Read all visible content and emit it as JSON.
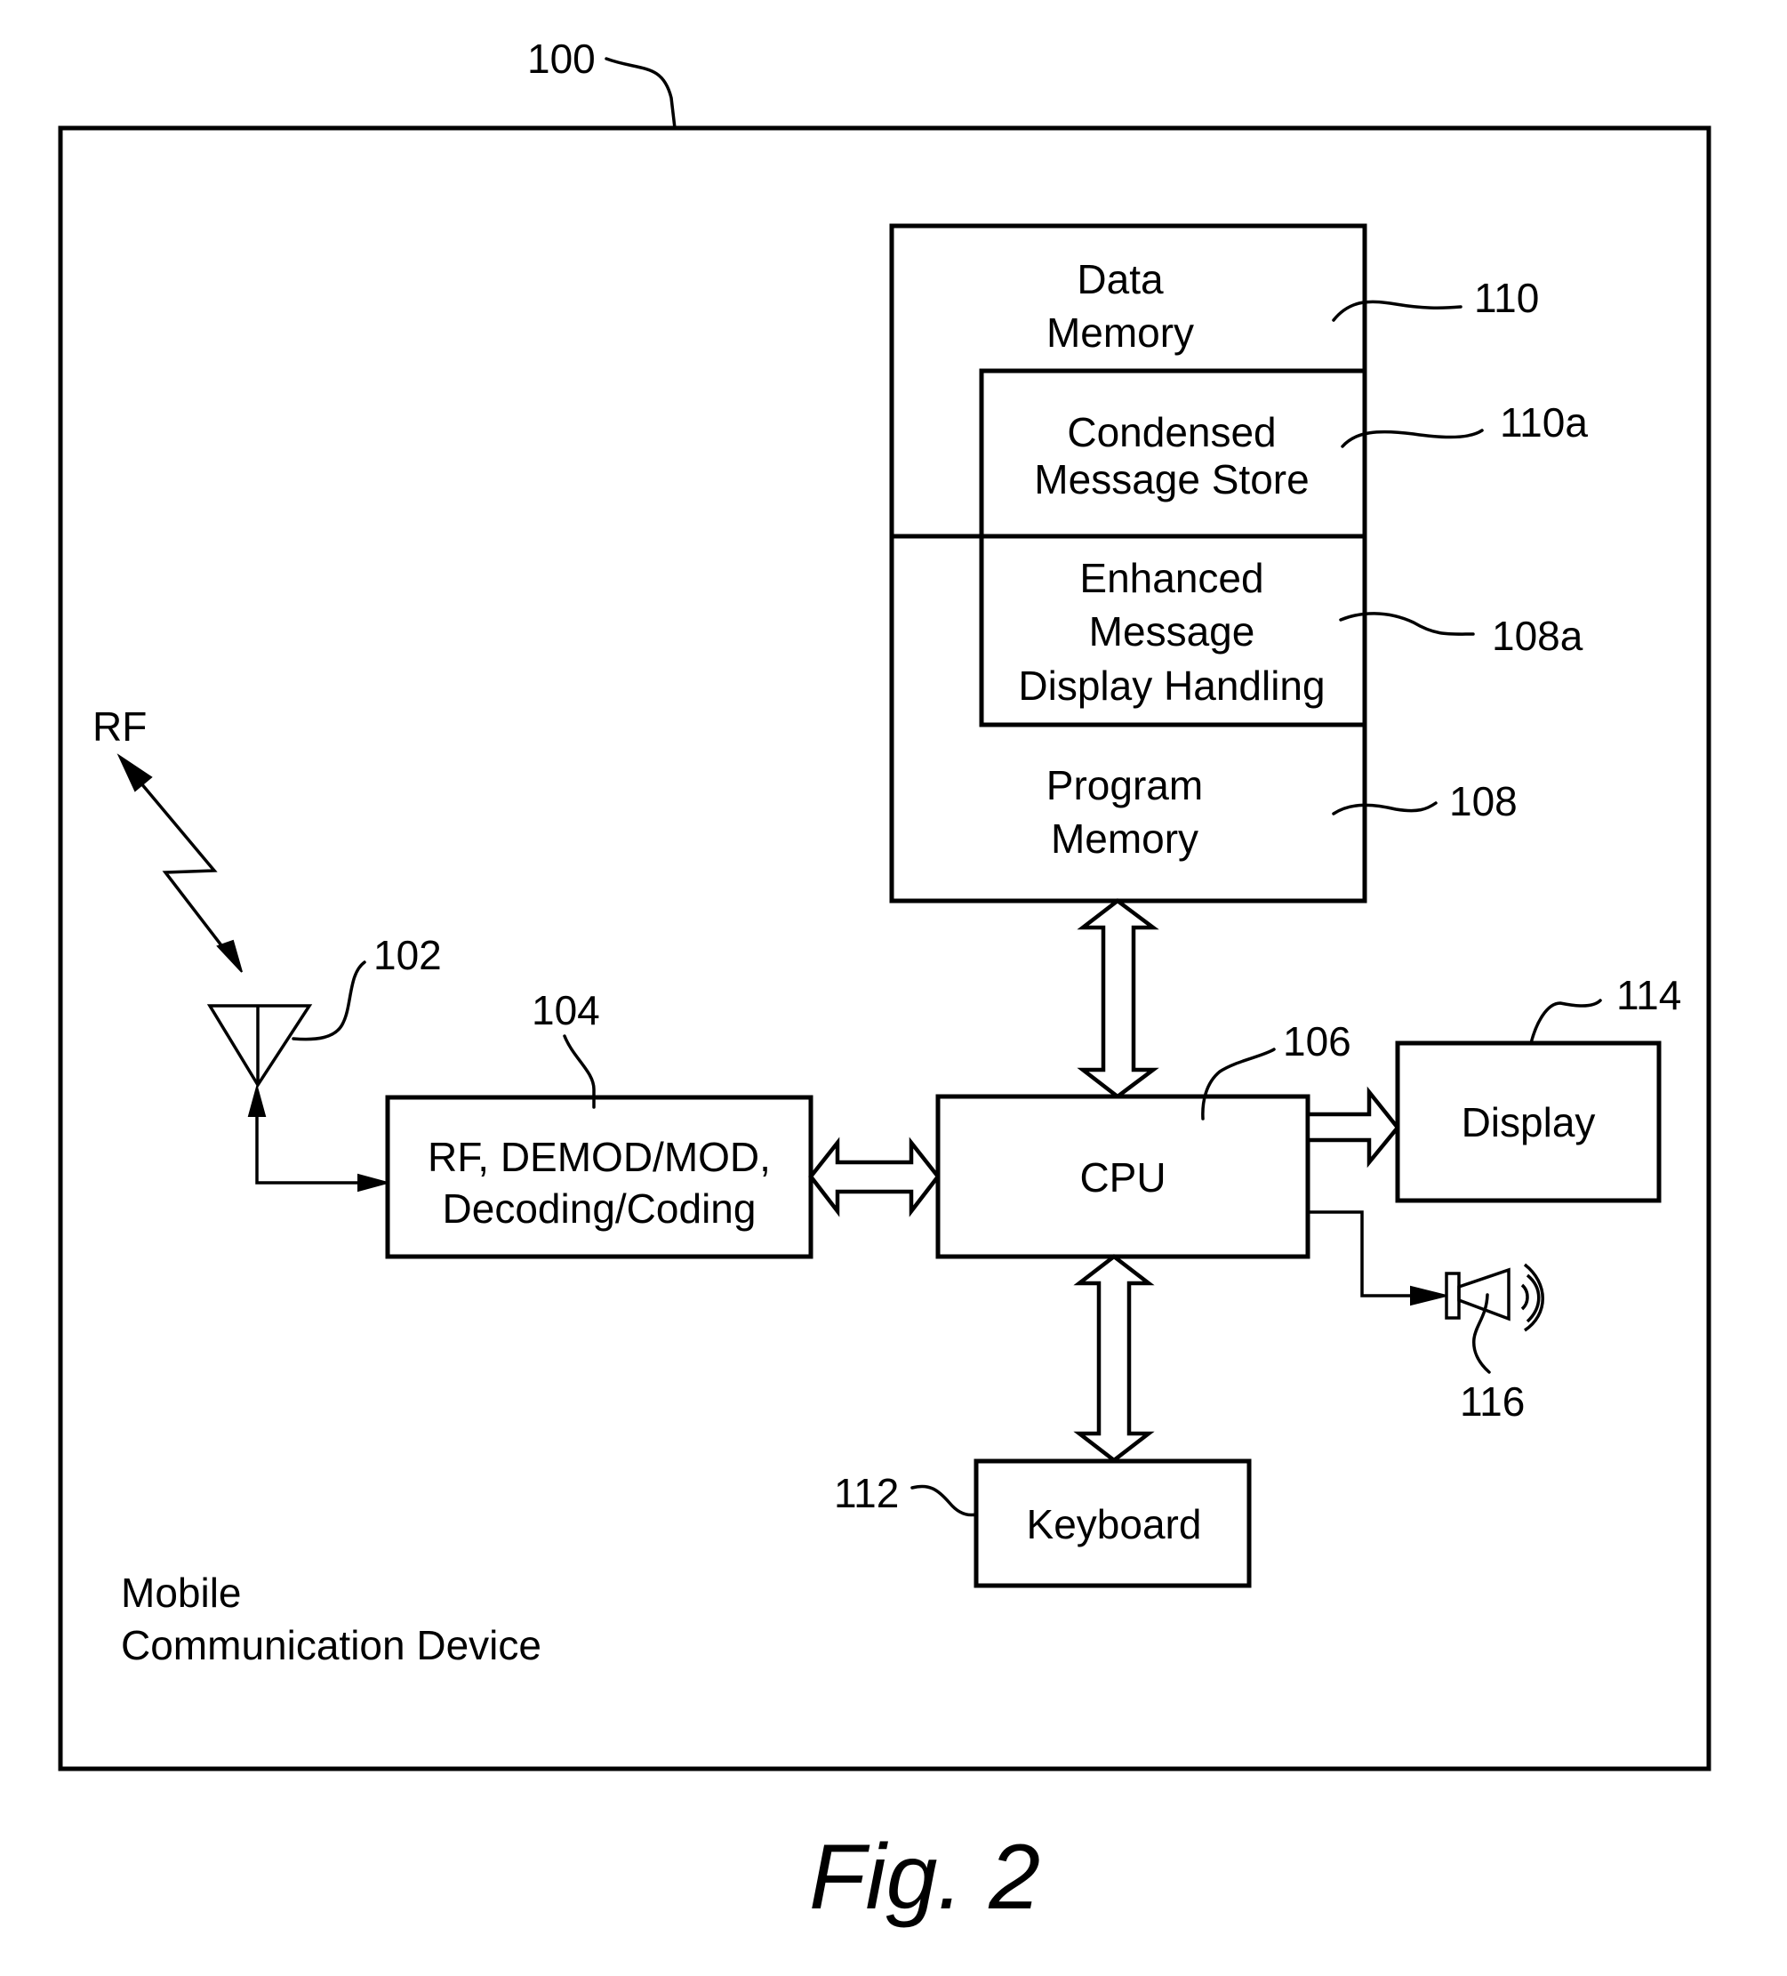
{
  "figure": {
    "caption": "Fig. 2",
    "device_ref": "100",
    "device_label": [
      "Mobile",
      "Communication Device"
    ]
  },
  "rf_signal": {
    "label": "RF"
  },
  "antenna": {
    "ref": "102"
  },
  "rf_module": {
    "ref": "104",
    "lines": [
      "RF, DEMOD/MOD,",
      "Decoding/Coding"
    ]
  },
  "cpu": {
    "ref": "106",
    "label": "CPU"
  },
  "memory": {
    "data_memory": {
      "ref": "110",
      "lines": [
        "Data",
        "Memory"
      ]
    },
    "condensed_store": {
      "ref": "110a",
      "lines": [
        "Condensed",
        "Message Store"
      ]
    },
    "enhanced_handling": {
      "ref": "108a",
      "lines": [
        "Enhanced",
        "Message",
        "Display Handling"
      ]
    },
    "program_memory": {
      "ref": "108",
      "lines": [
        "Program",
        "Memory"
      ]
    }
  },
  "display": {
    "ref": "114",
    "label": "Display"
  },
  "keyboard": {
    "ref": "112",
    "label": "Keyboard"
  },
  "speaker": {
    "ref": "116"
  }
}
